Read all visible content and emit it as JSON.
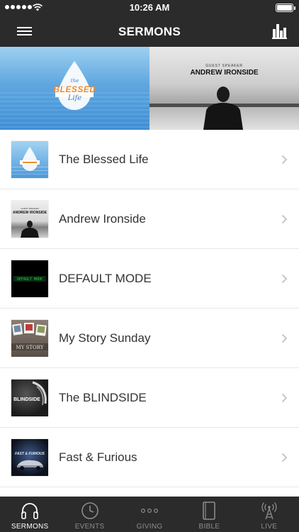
{
  "status_bar": {
    "time": "10:26 AM"
  },
  "nav": {
    "title": "SERMONS"
  },
  "banners": {
    "left": {
      "the": "the",
      "title": "BLESSED",
      "subtitle": "Life"
    },
    "right": {
      "caption": "GUEST SPEAKER",
      "name": "ANDREW IRONSIDE"
    }
  },
  "sermons": [
    {
      "title": "The Blessed Life",
      "thumb": "blessed"
    },
    {
      "title": "Andrew Ironside",
      "thumb": "guest"
    },
    {
      "title": "DEFAULT MODE",
      "thumb": "default"
    },
    {
      "title": "My Story Sunday",
      "thumb": "mystory"
    },
    {
      "title": "The BLINDSIDE",
      "thumb": "blindside"
    },
    {
      "title": "Fast & Furious",
      "thumb": "furious"
    }
  ],
  "thumbs": {
    "guest_caption": "GUEST SPEAKER",
    "guest_name": "ANDREW IRONSIDE",
    "default_text": "DEFAULT MODE",
    "mystory_text": "MY STORY",
    "blindside_text": "BLINDSIDE",
    "furious_text": "FAST & FURIOUS"
  },
  "tabs": [
    {
      "label": "SERMONS",
      "icon": "headphones-icon",
      "active": true
    },
    {
      "label": "EVENTS",
      "icon": "clock-icon",
      "active": false
    },
    {
      "label": "GIVING",
      "icon": "dots-icon",
      "active": false
    },
    {
      "label": "BIBLE",
      "icon": "book-icon",
      "active": false
    },
    {
      "label": "LIVE",
      "icon": "broadcast-tower-icon",
      "active": false
    }
  ],
  "colors": {
    "bar_background": "#2b2b2b",
    "tab_active": "#ffffff",
    "tab_inactive": "#8c8c8c",
    "title_text": "#333333",
    "chevron": "#c7c7cc",
    "default_mode_green": "#1dd43f"
  }
}
